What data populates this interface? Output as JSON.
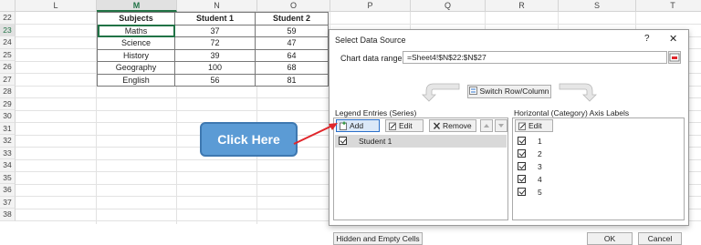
{
  "spreadsheet": {
    "columns": [
      {
        "name": "L",
        "selected": false
      },
      {
        "name": "M",
        "selected": true
      },
      {
        "name": "N",
        "selected": false
      },
      {
        "name": "O",
        "selected": false
      },
      {
        "name": "P",
        "selected": false
      },
      {
        "name": "Q",
        "selected": false
      },
      {
        "name": "R",
        "selected": false
      },
      {
        "name": "S",
        "selected": false
      },
      {
        "name": "T",
        "selected": false
      }
    ],
    "rows": [
      "22",
      "23",
      "24",
      "25",
      "26",
      "27",
      "28",
      "29",
      "30",
      "31",
      "32",
      "33",
      "34",
      "35",
      "36",
      "37",
      "38"
    ],
    "selected_row": "23",
    "table_headers": [
      "Subjects",
      "Student 1",
      "Student 2"
    ],
    "table_rows": [
      [
        "Maths",
        "37",
        "59"
      ],
      [
        "Science",
        "72",
        "47"
      ],
      [
        "History",
        "39",
        "64"
      ],
      [
        "Geography",
        "100",
        "68"
      ],
      [
        "English",
        "56",
        "81"
      ]
    ],
    "grid_color": "#e2e2e2",
    "selection_color": "#217346"
  },
  "dialog": {
    "title": "Select Data Source",
    "help_icon": "?",
    "close_icon": "✕",
    "chart_range_label": "Chart data range:",
    "chart_range_value": "=Sheet4!$N$22:$N$27",
    "switch_button_label": "Switch Row/Column",
    "legend_title": "Legend Entries (Series)",
    "legend_buttons": {
      "add": "Add",
      "edit": "Edit",
      "remove": "Remove"
    },
    "series": [
      {
        "label": "Student 1",
        "checked": true,
        "selected": true
      }
    ],
    "axis_title": "Horizontal (Category) Axis Labels",
    "axis_edit_button": "Edit",
    "axis_labels": [
      {
        "label": "1",
        "checked": true
      },
      {
        "label": "2",
        "checked": true
      },
      {
        "label": "3",
        "checked": true
      },
      {
        "label": "4",
        "checked": true
      },
      {
        "label": "5",
        "checked": true
      }
    ],
    "hidden_cells_button": "Hidden and Empty Cells",
    "ok_button": "OK",
    "cancel_button": "Cancel"
  },
  "callout": {
    "text": "Click Here",
    "fill_color": "#5b9bd5",
    "arrow_color": "#e0262b"
  }
}
